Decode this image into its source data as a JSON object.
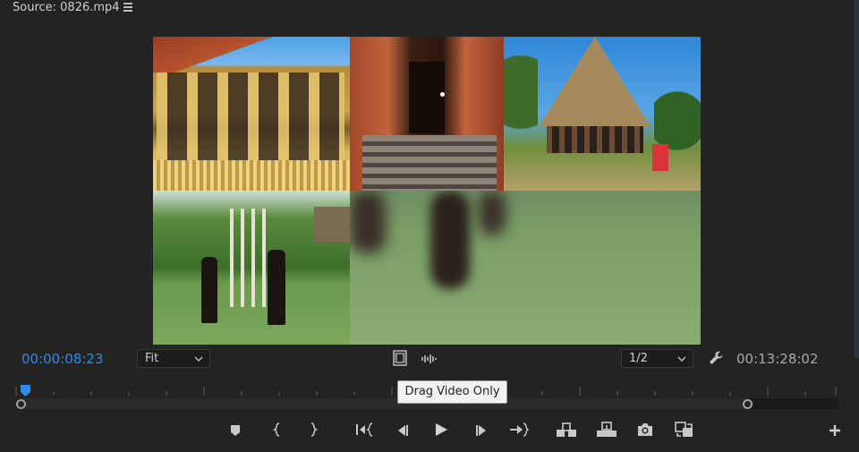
{
  "panel": {
    "title": "Source: 0826.mp4",
    "menu_icon": "hamburger-menu-icon"
  },
  "video": {
    "tiles": [
      "temple",
      "stairs",
      "thatched-hut",
      "dancers",
      "blurred-dancers"
    ]
  },
  "controls": {
    "current_time": "00:00:08:23",
    "duration": "00:13:28:02",
    "zoom_select": {
      "value": "Fit"
    },
    "resolution_select": {
      "value": "1/2"
    },
    "tooltip": "Drag Video Only",
    "accent_color": "#2d8ceb"
  },
  "transport_icons": [
    "add-marker-icon",
    "mark-in-icon",
    "mark-out-icon",
    "go-to-in-icon",
    "step-back-icon",
    "play-icon",
    "step-forward-icon",
    "go-to-out-icon",
    "insert-icon",
    "overwrite-icon",
    "export-frame-icon",
    "swap-icon",
    "add-button-icon"
  ]
}
